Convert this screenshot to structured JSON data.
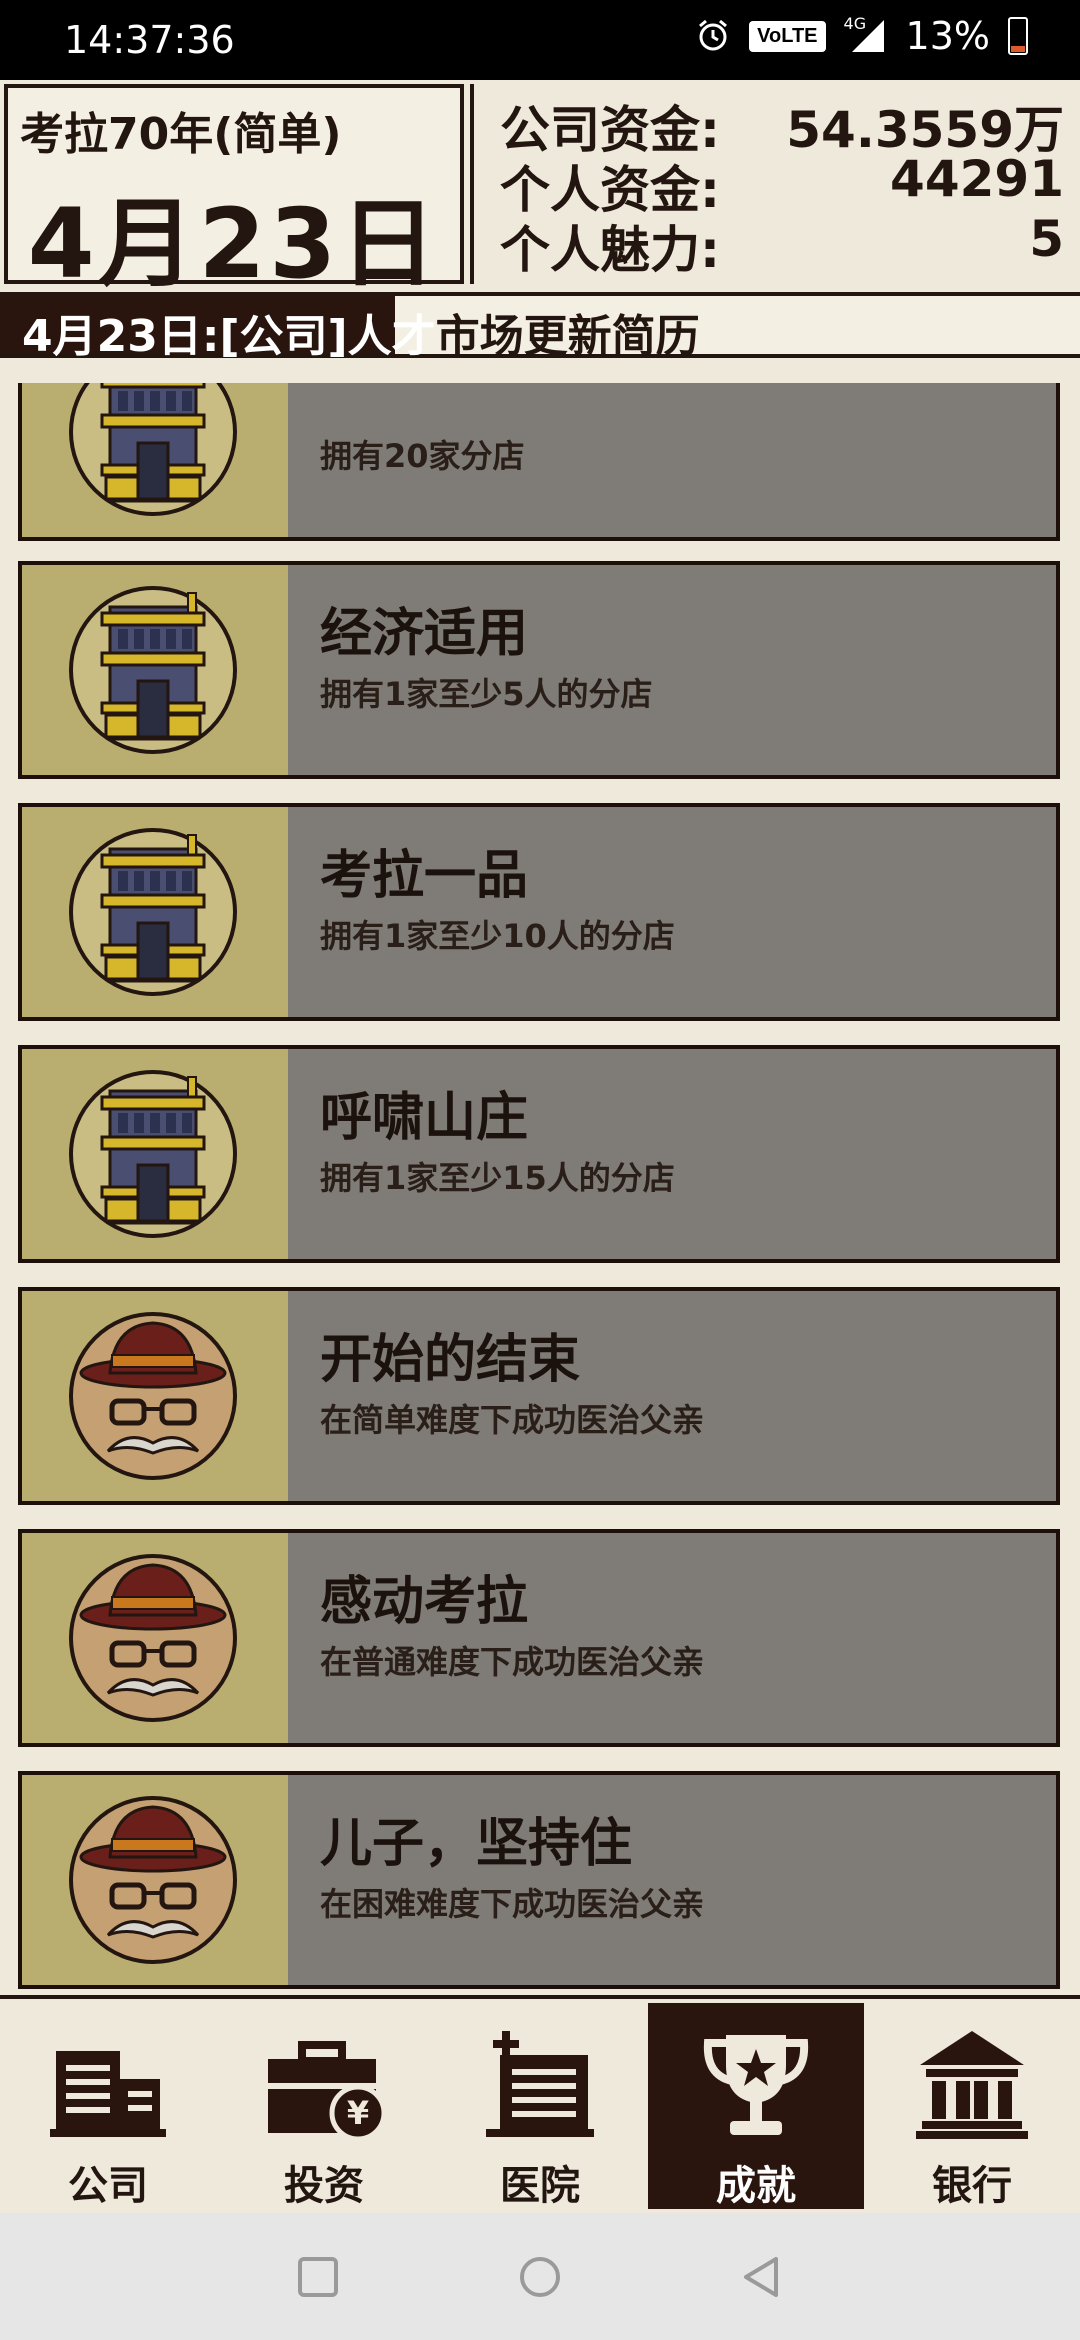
{
  "status_bar": {
    "time": "14:37:36",
    "volte": "VoLTE",
    "network": "4G",
    "battery": "13%"
  },
  "header": {
    "game_label": "考拉70年(简单)",
    "date": "4月23日",
    "company_funds_label": "公司资金:",
    "company_funds_value": "54.3559万",
    "personal_funds_label": "个人资金:",
    "personal_funds_value": "44291",
    "charm_label": "个人魅力:",
    "charm_value": "5"
  },
  "ticker": {
    "text_dark": "4月23日:[公司]人才",
    "text_light": "市场更新简历"
  },
  "achievements": [
    {
      "title": "",
      "desc": "拥有20家分店",
      "icon": "building-icon"
    },
    {
      "title": "经济适用",
      "desc": "拥有1家至少5人的分店",
      "icon": "building-icon"
    },
    {
      "title": "考拉一品",
      "desc": "拥有1家至少10人的分店",
      "icon": "building-icon"
    },
    {
      "title": "呼啸山庄",
      "desc": "拥有1家至少15人的分店",
      "icon": "building-icon"
    },
    {
      "title": "开始的结束",
      "desc": "在简单难度下成功医治父亲",
      "icon": "father-face-icon"
    },
    {
      "title": "感动考拉",
      "desc": "在普通难度下成功医治父亲",
      "icon": "father-face-icon"
    },
    {
      "title": "儿子，坚持住",
      "desc": "在困难难度下成功医治父亲",
      "icon": "father-face-icon"
    }
  ],
  "nav": [
    {
      "label": "公司",
      "icon": "company-icon"
    },
    {
      "label": "投资",
      "icon": "investment-icon"
    },
    {
      "label": "医院",
      "icon": "hospital-icon"
    },
    {
      "label": "成就",
      "icon": "trophy-icon",
      "active": true
    },
    {
      "label": "银行",
      "icon": "bank-icon"
    }
  ],
  "colors": {
    "background": "#efe9dc",
    "dark": "#2a140e",
    "card_body": "#7f7b76",
    "card_icon_bg": "#b9ad6f"
  }
}
